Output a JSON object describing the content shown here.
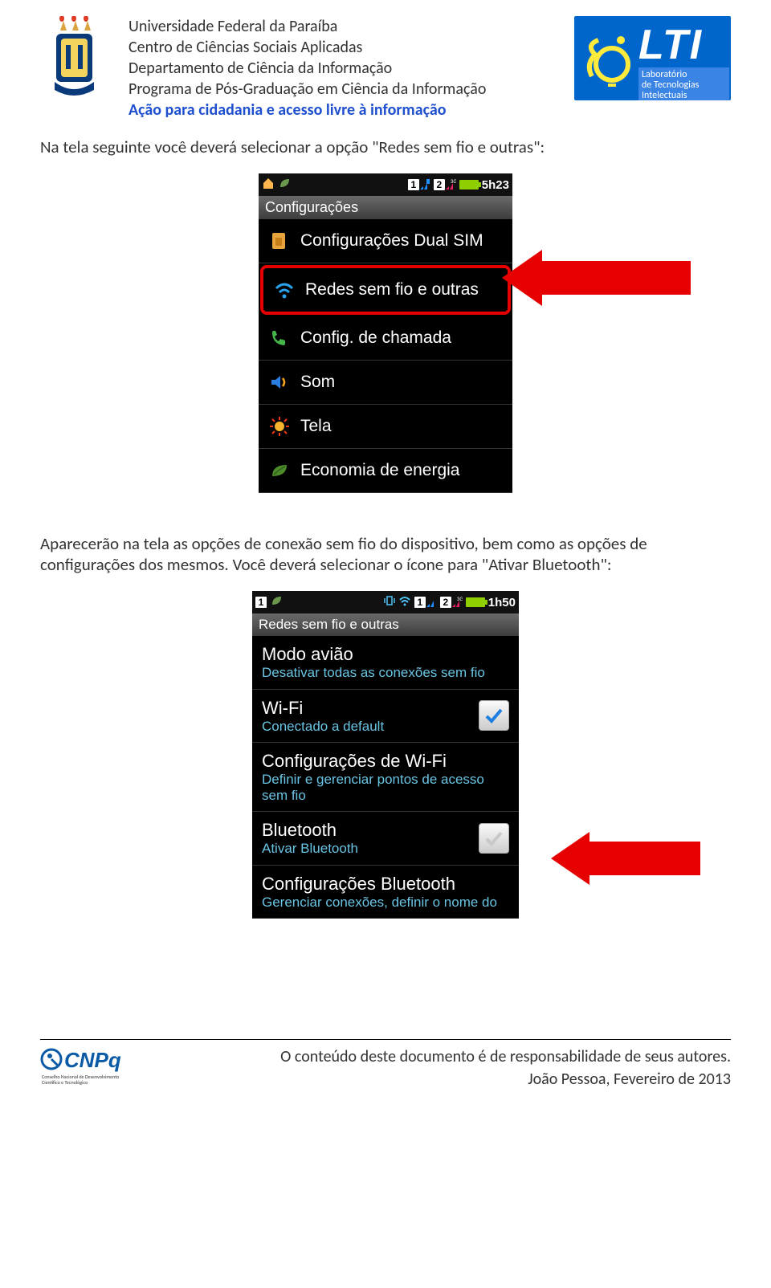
{
  "header": {
    "line1": "Universidade Federal da Paraíba",
    "line2": "Centro de Ciências Sociais Aplicadas",
    "line3": "Departamento de Ciência da Informação",
    "line4": "Programa de Pós-Graduação em Ciência da Informação",
    "acao": "Ação para cidadania e acesso livre à informação",
    "lti_letters": "LTI",
    "lti_sub1": "Laboratório",
    "lti_sub2": "de Tecnologias",
    "lti_sub3": "Intelectuais"
  },
  "para1": "Na tela seguinte você deverá selecionar a opção \"Redes sem fio e outras\":",
  "phone1": {
    "time": "5h23",
    "section": "Configurações",
    "rows": [
      {
        "icon": "sim-card-icon",
        "label": "Configurações Dual SIM"
      },
      {
        "icon": "wifi-icon",
        "label": "Redes sem fio e outras",
        "highlight": true
      },
      {
        "icon": "phone-icon",
        "label": "Config. de chamada"
      },
      {
        "icon": "speaker-icon",
        "label": "Som"
      },
      {
        "icon": "sun-icon",
        "label": "Tela"
      },
      {
        "icon": "leaf-icon",
        "label": "Economia de energia"
      }
    ]
  },
  "para2": "Aparecerão na tela as opções de conexão sem fio do dispositivo, bem como as opções de configurações dos mesmos. Você deverá selecionar o ícone para \"Ativar Bluetooth\":",
  "phone2": {
    "time": "1h50",
    "section": "Redes sem fio e outras",
    "rows": [
      {
        "title": "Modo avião",
        "sub": "Desativar todas as conexões sem fio",
        "check": false
      },
      {
        "title": "Wi-Fi",
        "sub": "Conectado a default",
        "check": true,
        "checked": true
      },
      {
        "title": "Configurações de Wi-Fi",
        "sub": "Definir e gerenciar pontos de acesso sem fio"
      },
      {
        "title": "Bluetooth",
        "sub": "Ativar Bluetooth",
        "check": true,
        "checked": false,
        "arrow": true
      },
      {
        "title": "Configurações Bluetooth",
        "sub": "Gerenciar conexões, definir o nome do"
      }
    ]
  },
  "footer": {
    "line1": "O conteúdo deste documento é de responsabilidade de seus autores.",
    "line2": "João Pessoa, Fevereiro de 2013",
    "cnpq": "CNPq"
  }
}
